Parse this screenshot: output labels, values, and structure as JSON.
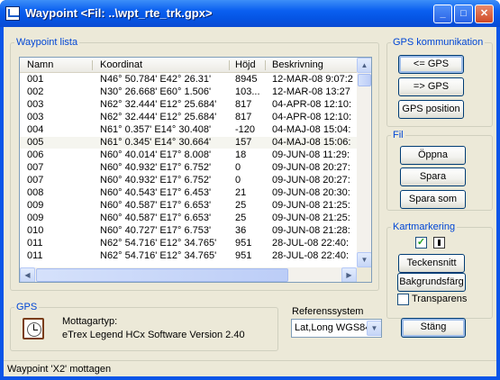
{
  "window": {
    "title": "Waypoint <Fil: ..\\wpt_rte_trk.gpx>",
    "minimize_glyph": "_",
    "maximize_glyph": "□",
    "close_glyph": "✕"
  },
  "waypoint_list": {
    "legend": "Waypoint lista",
    "columns": [
      "Namn",
      "Koordinat",
      "Höjd",
      "Beskrivning"
    ],
    "rows": [
      {
        "name": "001",
        "coord": "N46° 50.784' E42° 26.31'",
        "height": "8945",
        "desc": "12-MAR-08 9:07:2"
      },
      {
        "name": "002",
        "coord": "N30° 26.668' E60° 1.506'",
        "height": "103...",
        "desc": "12-MAR-08 13:27"
      },
      {
        "name": "003",
        "coord": "N62° 32.444' E12° 25.684'",
        "height": "817",
        "desc": "04-APR-08 12:10:"
      },
      {
        "name": "003",
        "coord": "N62° 32.444' E12° 25.684'",
        "height": "817",
        "desc": "04-APR-08 12:10:"
      },
      {
        "name": "004",
        "coord": "N61° 0.357' E14° 30.408'",
        "height": "-120",
        "desc": "04-MAJ-08 15:04:"
      },
      {
        "name": "005",
        "coord": "N61° 0.345' E14° 30.664'",
        "height": "157",
        "desc": "04-MAJ-08 15:06:"
      },
      {
        "name": "006",
        "coord": "N60° 40.014' E17° 8.008'",
        "height": "18",
        "desc": "09-JUN-08 11:29:"
      },
      {
        "name": "007",
        "coord": "N60° 40.932' E17° 6.752'",
        "height": "0",
        "desc": "09-JUN-08 20:27:"
      },
      {
        "name": "007",
        "coord": "N60° 40.932' E17° 6.752'",
        "height": "0",
        "desc": "09-JUN-08 20:27:"
      },
      {
        "name": "008",
        "coord": "N60° 40.543' E17° 6.453'",
        "height": "21",
        "desc": "09-JUN-08 20:30:"
      },
      {
        "name": "009",
        "coord": "N60° 40.587' E17° 6.653'",
        "height": "25",
        "desc": "09-JUN-08 21:25:"
      },
      {
        "name": "009",
        "coord": "N60° 40.587' E17° 6.653'",
        "height": "25",
        "desc": "09-JUN-08 21:25:"
      },
      {
        "name": "010",
        "coord": "N60° 40.727' E17° 6.753'",
        "height": "36",
        "desc": "09-JUN-08 21:28:"
      },
      {
        "name": "011",
        "coord": "N62° 54.716' E12° 34.765'",
        "height": "951",
        "desc": "28-JUL-08 22:40:"
      },
      {
        "name": "011",
        "coord": "N62° 54.716' E12° 34.765'",
        "height": "951",
        "desc": "28-JUL-08 22:40:"
      }
    ],
    "selected_row_name": "005"
  },
  "gps_group": {
    "legend": "GPS",
    "receiver_label": "Mottagartyp:",
    "receiver_value": "eTrex Legend HCx Software Version 2.40"
  },
  "reference_system": {
    "label": "Referenssystem",
    "selected": "Lat,Long WGS84"
  },
  "gps_komm": {
    "legend": "GPS kommunikation",
    "from_gps": "<= GPS",
    "to_gps": "=> GPS",
    "gps_position": "GPS position"
  },
  "fil": {
    "legend": "Fil",
    "open": "Öppna",
    "save": "Spara",
    "save_as": "Spara som"
  },
  "kartmarkering": {
    "legend": "Kartmarkering",
    "check_glyph": "✓",
    "font_button": "Teckensnitt",
    "bg_button": "Bakgrundsfärg",
    "transparent_label": "Transparens"
  },
  "close_button": "Stäng",
  "status": "Waypoint 'X2' mottagen"
}
